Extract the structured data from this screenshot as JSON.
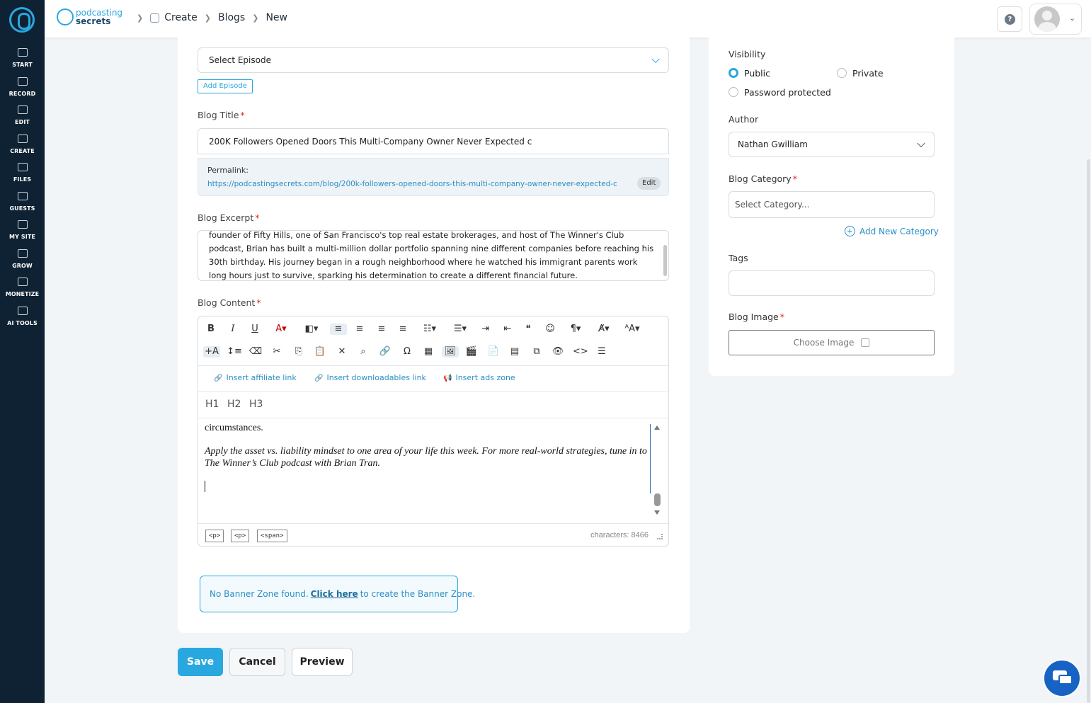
{
  "rail": {
    "items": [
      {
        "label": "START"
      },
      {
        "label": "RECORD"
      },
      {
        "label": "EDIT"
      },
      {
        "label": "CREATE"
      },
      {
        "label": "FILES"
      },
      {
        "label": "GUESTS"
      },
      {
        "label": "MY SITE"
      },
      {
        "label": "GROW"
      },
      {
        "label": "MONETIZE"
      },
      {
        "label": "AI TOOLS"
      }
    ]
  },
  "header": {
    "brand_line1": "podcasting",
    "brand_line2": "secrets",
    "breadcrumbs": [
      "Create",
      "Blogs",
      "New"
    ],
    "help_glyph": "?"
  },
  "form": {
    "episode_select": "Select Episode",
    "add_episode": "Add Episode",
    "title_label": "Blog Title",
    "title_value": "200K Followers Opened Doors  This Multi-Company Owner Never Expected c",
    "permalink_label": "Permalink:",
    "permalink_url": "https://podcastingsecrets.com/blog/200k-followers-opened-doors-this-multi-company-owner-never-expected-c",
    "permalink_edit": "Edit",
    "excerpt_label": "Blog Excerpt",
    "excerpt_text": "founder of Fifty Hills, one of San Francisco's top real estate brokerages, and host of The Winner's Club podcast, Brian has built a multi-million dollar portfolio spanning nine different companies before reaching his 30th birthday. His journey began in a rough neighborhood where he watched his immigrant parents work long hours just to survive, sparking his determination to create a different financial future.",
    "content_label": "Blog Content",
    "required_mark": "*"
  },
  "editor": {
    "insert_affiliate": "Insert affiliate link",
    "insert_downloadables": "Insert downloadables link",
    "insert_ads": "Insert ads zone",
    "headings": [
      "H1",
      "H2",
      "H3"
    ],
    "body_p1": "circumstances.",
    "body_p2": "Apply the asset vs. liability mindset to one area of your life this week. For more real-world strategies, tune in to The Winner’s Club podcast with Brian Tran.",
    "path_tags": [
      "<p>",
      "<p>",
      "<span>"
    ],
    "char_count": "characters: 8466",
    "toolbar_row1": [
      "B",
      "I",
      "U",
      "A▾",
      "◧▾",
      "≡",
      "≡",
      "≡",
      "≡",
      "☷▾",
      "☰▾",
      "⇥",
      "⇤",
      "❝",
      "☺",
      "¶▾",
      "A̸▾",
      "ᴬA▾"
    ],
    "toolbar_row2": [
      "+A",
      "↕≡",
      "⌫",
      "✂",
      "⎘",
      "📋",
      "✕",
      "⌕",
      "🔗",
      "Ω",
      "▦",
      "🖼",
      "🎬",
      "📄",
      "▤",
      "⧉",
      "👁",
      "<>",
      "☰"
    ]
  },
  "banner": {
    "text_before": "No Banner Zone found.",
    "link": "Click here",
    "text_after": "to create the Banner Zone."
  },
  "actions": {
    "save": "Save",
    "cancel": "Cancel",
    "preview": "Preview"
  },
  "sidebar": {
    "visibility_label": "Visibility",
    "visibility_options": [
      "Public",
      "Private",
      "Password protected"
    ],
    "visibility_selected": "Public",
    "author_label": "Author",
    "author_value": "Nathan Gwilliam",
    "category_label": "Blog Category",
    "category_placeholder": "Select Category...",
    "add_category": "Add New Category",
    "tags_label": "Tags",
    "image_label": "Blog Image",
    "choose_image": "Choose Image"
  },
  "colors": {
    "accent": "#29a8df",
    "rail": "#0f2233",
    "required": "#e02424",
    "chat": "#1763c4"
  }
}
